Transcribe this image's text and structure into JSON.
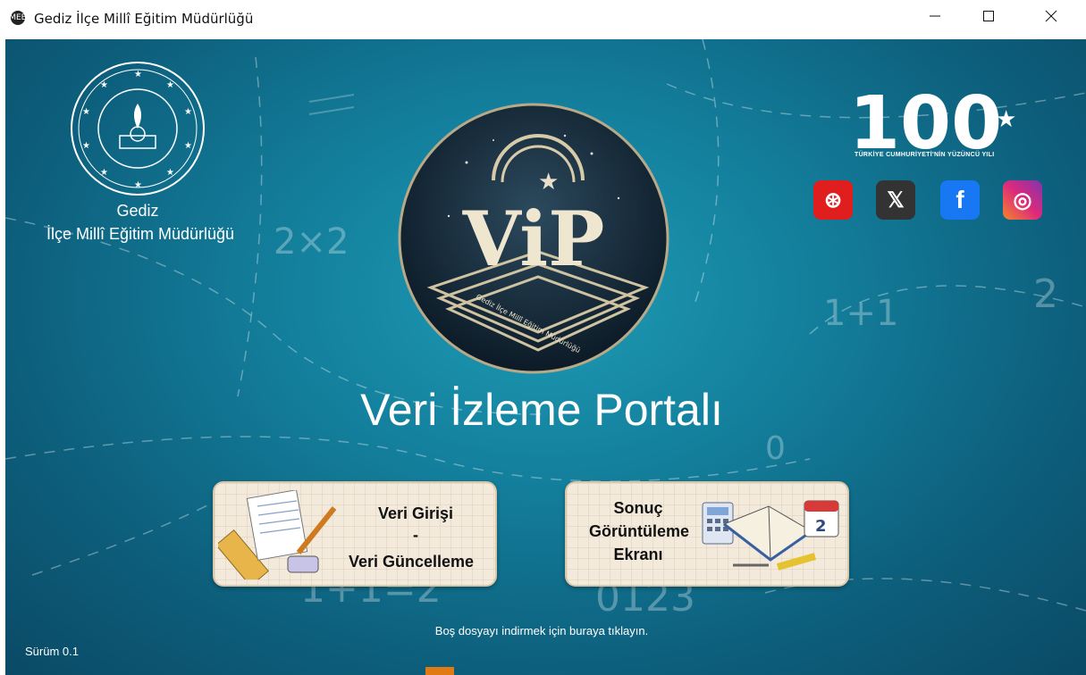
{
  "window": {
    "title": "Gediz İlçe Millî Eğitim Müdürlüğü",
    "app_icon": "MEB",
    "controls": {
      "minimize": "—",
      "maximize": "☐",
      "close": "✕"
    }
  },
  "org": {
    "line1": "Gediz",
    "line2": "İlçe Millî Eğitim Müdürlüğü"
  },
  "portal": {
    "title": "Veri İzleme Portalı",
    "logo_text": "ViP",
    "logo_subtext": "Gediz İlçe Millî Eğitim Müdürlüğü"
  },
  "centennial": {
    "number": "100",
    "subtitle": "TÜRKİYE CUMHURİYETİ'NİN YÜZÜNCÜ YILI"
  },
  "social": [
    {
      "name": "dribbble",
      "glyph": "⊛"
    },
    {
      "name": "x",
      "glyph": "𝕏"
    },
    {
      "name": "facebook",
      "glyph": "f"
    },
    {
      "name": "instagram",
      "glyph": "◎"
    }
  ],
  "buttons": {
    "data_entry": {
      "line1": "Veri Girişi",
      "line2": "-",
      "line3": "Veri Güncelleme"
    },
    "results": {
      "line1": "Sonuç",
      "line2": "Görüntüleme",
      "line3": "Ekranı",
      "calendar_day": "2"
    }
  },
  "download_link": "Boş dosyayı indirmek için buraya tıklayın.",
  "version": "Sürüm 0.1",
  "colors": {
    "background": "#137f9c",
    "card": "#f3eadc",
    "accent": "#e07a12"
  }
}
